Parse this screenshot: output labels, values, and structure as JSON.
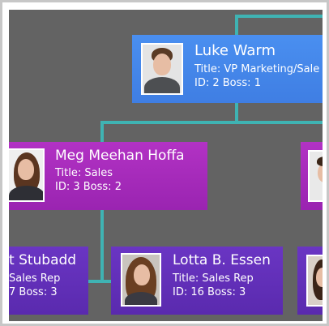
{
  "diagram": {
    "nodes": [
      {
        "id": "luke",
        "name": "Luke Warm",
        "title": "Title: VP Marketing/Sale",
        "idboss": "ID: 2  Boss: 1",
        "photo": "man-avatar"
      },
      {
        "id": "meg",
        "name": "Meg Meehan Hoffa",
        "title": "Title: Sales",
        "idboss": "ID: 3  Boss: 2",
        "photo": "woman-avatar"
      },
      {
        "id": "stubadd",
        "name": "t Stubadd",
        "title": "Sales Rep",
        "idboss": "7  Boss: 3",
        "photo": ""
      },
      {
        "id": "lotta",
        "name": "Lotta B. Essen",
        "title": "Title:  Sales Rep",
        "idboss": "ID: 16  Boss: 3",
        "photo": "woman-avatar"
      }
    ],
    "colors": {
      "background": "#636363",
      "connector": "#3fb3b3",
      "blue_node": "#4485ea",
      "magenta_node": "#a52bbb",
      "violet_node": "#5f2fb8"
    }
  }
}
